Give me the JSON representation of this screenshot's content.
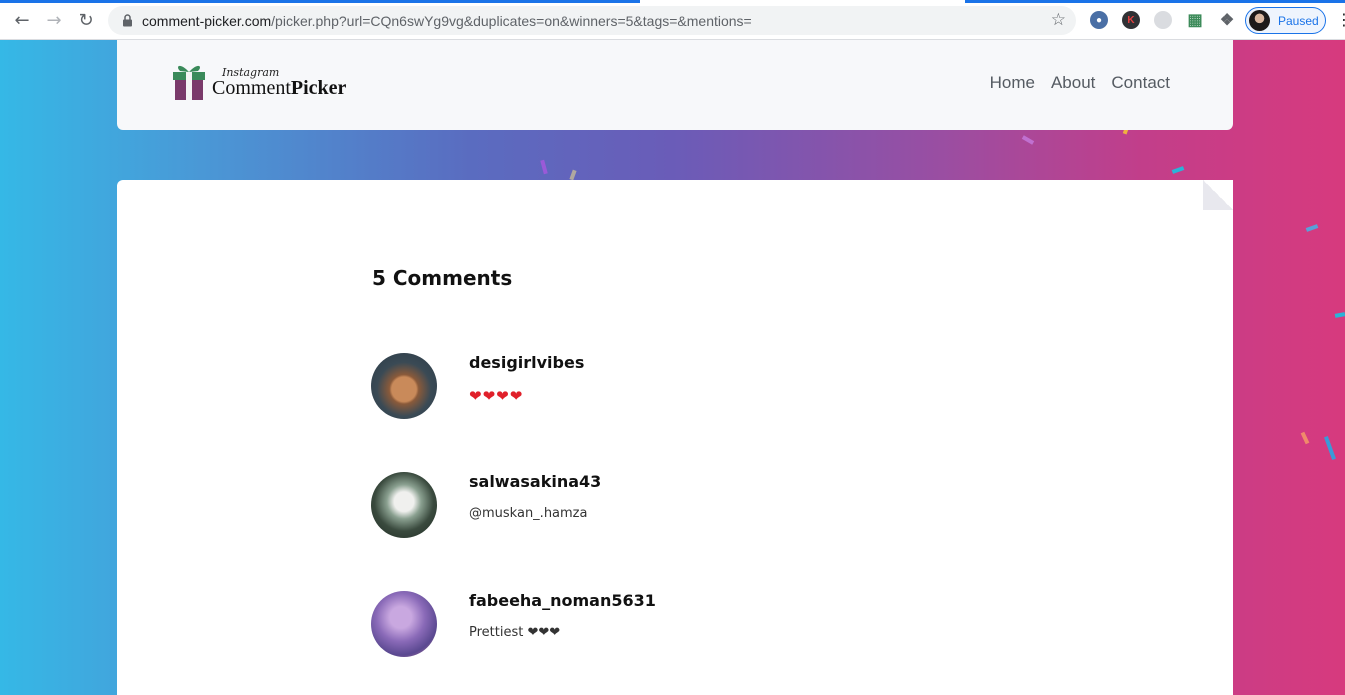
{
  "browser": {
    "url_host": "comment-picker.com",
    "url_path": "/picker.php?url=CQn6swYg9vg&duplicates=on&winners=5&tags=&mentions=",
    "profile_label": "Paused",
    "icons": [
      "back-icon",
      "forward-icon",
      "reload-icon",
      "lock-icon",
      "star-icon",
      "puzzle-icon",
      "menu-dots-icon"
    ]
  },
  "site": {
    "logo_script": "Instagram",
    "logo_main_regular": "Comment",
    "logo_main_bold": "Picker",
    "nav": [
      "Home",
      "About",
      "Contact"
    ]
  },
  "content": {
    "title": "5 Comments",
    "comments": [
      {
        "username": "desigirlvibes",
        "text": "❤❤❤❤"
      },
      {
        "username": "salwasakina43",
        "text": "@muskan_.hamza"
      },
      {
        "username": "fabeeha_noman5631",
        "text": "Prettiest ❤❤❤"
      }
    ]
  },
  "colors": {
    "brand_blue": "#1a73e8",
    "gradient_left": "#35b8e6",
    "gradient_right": "#d73a7e"
  }
}
